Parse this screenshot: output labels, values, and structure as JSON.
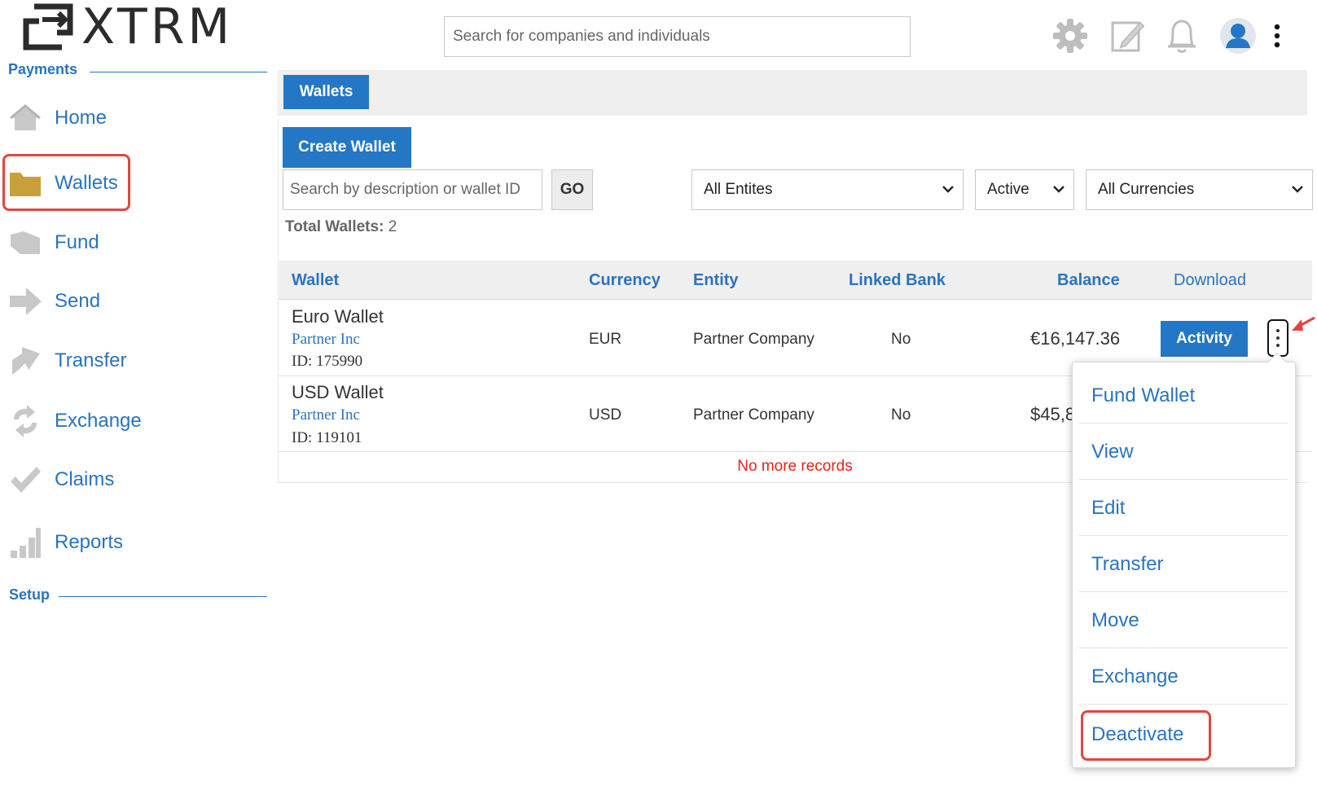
{
  "brand": {
    "name": "XTRM",
    "accent": "#2a73bd",
    "primary_button": "#2477c4",
    "highlight": "#e0473e"
  },
  "header": {
    "search_placeholder": "Search for companies and individuals",
    "icons": [
      "gear-icon",
      "edit-note-icon",
      "bell-icon",
      "user-avatar-icon",
      "more-vertical-icon"
    ]
  },
  "sidebar": {
    "payments_label": "Payments",
    "setup_label": "Setup",
    "items": [
      {
        "label": "Home",
        "icon": "home-icon"
      },
      {
        "label": "Wallets",
        "icon": "folder-icon",
        "active": true
      },
      {
        "label": "Fund",
        "icon": "fund-icon"
      },
      {
        "label": "Send",
        "icon": "send-arrow-icon"
      },
      {
        "label": "Transfer",
        "icon": "transfer-arrow-icon"
      },
      {
        "label": "Exchange",
        "icon": "exchange-icon"
      },
      {
        "label": "Claims",
        "icon": "checkmark-icon"
      },
      {
        "label": "Reports",
        "icon": "bar-chart-icon"
      }
    ]
  },
  "main": {
    "tab_label": "Wallets",
    "create_label": "Create Wallet",
    "search_placeholder": "Search by description or wallet ID",
    "go_label": "GO",
    "filters": {
      "entities": "All Entites",
      "status": "Active",
      "currency": "All Currencies"
    },
    "total_label": "Total Wallets:",
    "total_value": "2",
    "table": {
      "headers": {
        "wallet": "Wallet",
        "currency": "Currency",
        "entity": "Entity",
        "linked_bank": "Linked Bank",
        "balance": "Balance",
        "download": "Download"
      },
      "rows": [
        {
          "name": "Euro Wallet",
          "company": "Partner Inc",
          "id": "ID: 175990",
          "currency": "EUR",
          "entity": "Partner Company",
          "linked_bank": "No",
          "balance": "€16,147.36"
        },
        {
          "name": "USD Wallet",
          "company": "Partner Inc",
          "id": "ID: 119101",
          "currency": "USD",
          "entity": "Partner Company",
          "linked_bank": "No",
          "balance": "$45,8"
        }
      ],
      "activity_label": "Activity",
      "no_more": "No more records"
    },
    "menu": [
      "Fund Wallet",
      "View",
      "Edit",
      "Transfer",
      "Move",
      "Exchange",
      "Deactivate"
    ]
  }
}
